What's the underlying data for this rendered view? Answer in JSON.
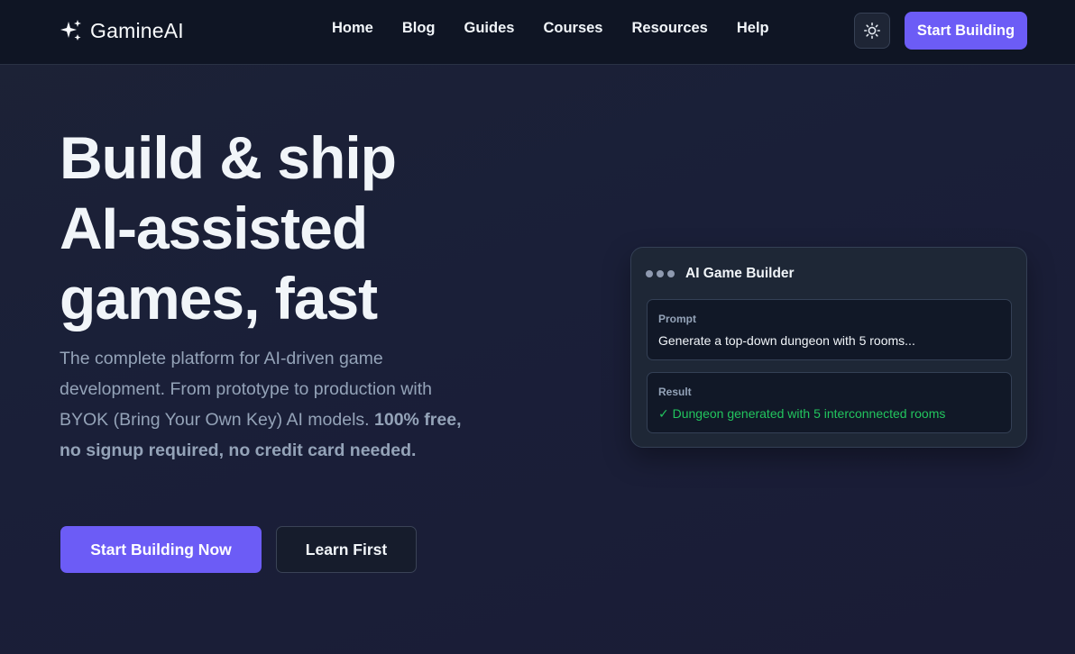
{
  "header": {
    "brand": "GamineAI",
    "brand_icon": "sparkles-icon",
    "nav": [
      "Home",
      "Blog",
      "Guides",
      "Courses",
      "Resources",
      "Help"
    ],
    "theme_toggle_icon": "sun-icon",
    "cta": "Start Building"
  },
  "hero": {
    "title_lines": [
      "Build & ship",
      "AI-assisted",
      "games, fast"
    ],
    "description": "The complete platform for AI-driven game development. From prototype to production with BYOK (Bring Your Own Key) AI models.",
    "description_bold": "100% free, no signup required, no credit card needed.",
    "primary_button": "Start Building Now",
    "secondary_button": "Learn First"
  },
  "builder_card": {
    "title": "AI Game Builder",
    "prompt_label": "Prompt",
    "prompt_text": "Generate a top-down dungeon with 5 rooms...",
    "result_label": "Result",
    "result_text": "✓ Dungeon generated with 5 interconnected rooms"
  },
  "colors": {
    "accent": "#6c5cf6",
    "background": "#1a1f38",
    "nav_background": "#0f1524",
    "success": "#22c55e",
    "muted_text": "#94a3b8"
  }
}
